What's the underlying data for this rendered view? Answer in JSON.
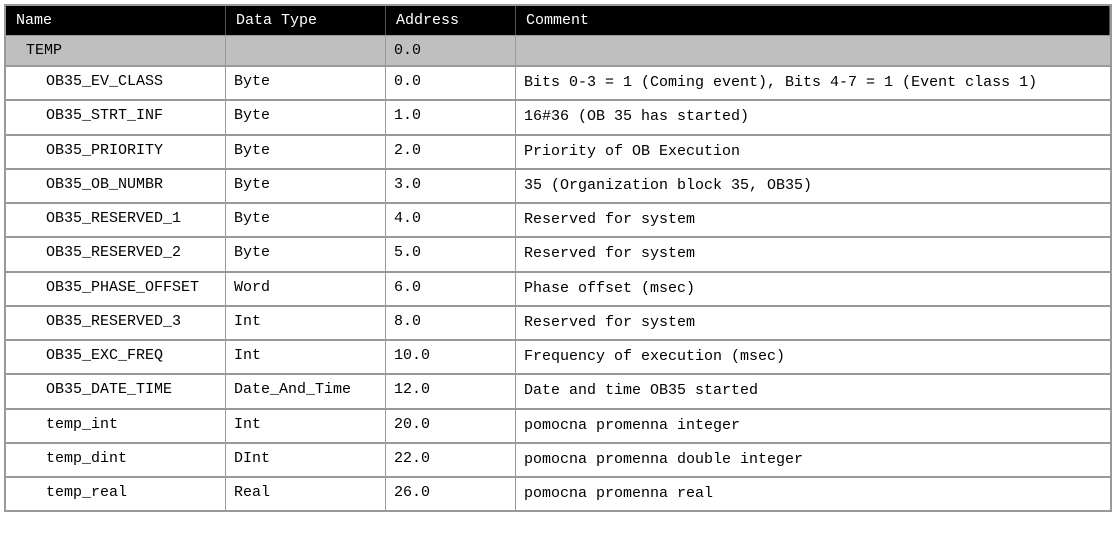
{
  "headers": {
    "name": "Name",
    "type": "Data Type",
    "address": "Address",
    "comment": "Comment"
  },
  "section": {
    "name": "TEMP",
    "type": "",
    "address": "0.0",
    "comment": ""
  },
  "rows": [
    {
      "name": "OB35_EV_CLASS",
      "type": "Byte",
      "address": "0.0",
      "comment": "Bits 0-3 = 1 (Coming event), Bits 4-7 = 1 (Event class 1)"
    },
    {
      "name": "OB35_STRT_INF",
      "type": "Byte",
      "address": "1.0",
      "comment": "16#36 (OB 35 has started)"
    },
    {
      "name": "OB35_PRIORITY",
      "type": "Byte",
      "address": "2.0",
      "comment": "Priority of OB Execution"
    },
    {
      "name": "OB35_OB_NUMBR",
      "type": "Byte",
      "address": "3.0",
      "comment": "35 (Organization block 35, OB35)"
    },
    {
      "name": "OB35_RESERVED_1",
      "type": "Byte",
      "address": "4.0",
      "comment": "Reserved for system"
    },
    {
      "name": "OB35_RESERVED_2",
      "type": "Byte",
      "address": "5.0",
      "comment": "Reserved for system"
    },
    {
      "name": "OB35_PHASE_OFFSET",
      "type": "Word",
      "address": "6.0",
      "comment": "Phase offset (msec)"
    },
    {
      "name": "OB35_RESERVED_3",
      "type": "Int",
      "address": "8.0",
      "comment": "Reserved for system"
    },
    {
      "name": "OB35_EXC_FREQ",
      "type": "Int",
      "address": "10.0",
      "comment": "Frequency of execution (msec)"
    },
    {
      "name": "OB35_DATE_TIME",
      "type": "Date_And_Time",
      "address": "12.0",
      "comment": "Date and time OB35 started"
    },
    {
      "name": "temp_int",
      "type": "Int",
      "address": "20.0",
      "comment": "pomocna promenna integer"
    },
    {
      "name": "temp_dint",
      "type": "DInt",
      "address": "22.0",
      "comment": "pomocna promenna double integer"
    },
    {
      "name": "temp_real",
      "type": "Real",
      "address": "26.0",
      "comment": "pomocna promenna real"
    }
  ]
}
